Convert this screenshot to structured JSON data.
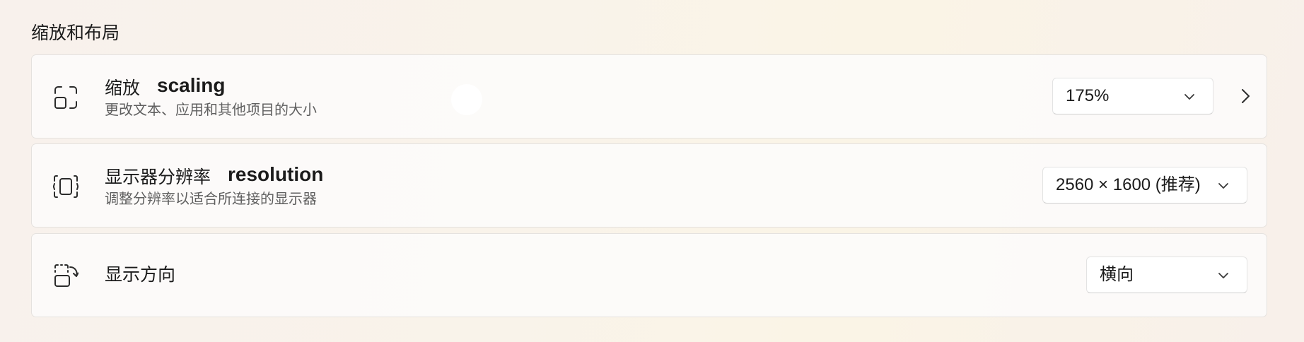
{
  "section": {
    "title": "缩放和布局"
  },
  "rows": [
    {
      "title": "缩放",
      "title_en": "scaling",
      "subtitle": "更改文本、应用和其他项目的大小",
      "value": "175%",
      "icon": "scale-icon"
    },
    {
      "title": "显示器分辨率",
      "title_en": "resolution",
      "subtitle": "调整分辨率以适合所连接的显示器",
      "value": "2560 × 1600 (推荐)",
      "icon": "resolution-icon"
    },
    {
      "title": "显示方向",
      "value": "横向",
      "icon": "rotate-icon"
    }
  ]
}
